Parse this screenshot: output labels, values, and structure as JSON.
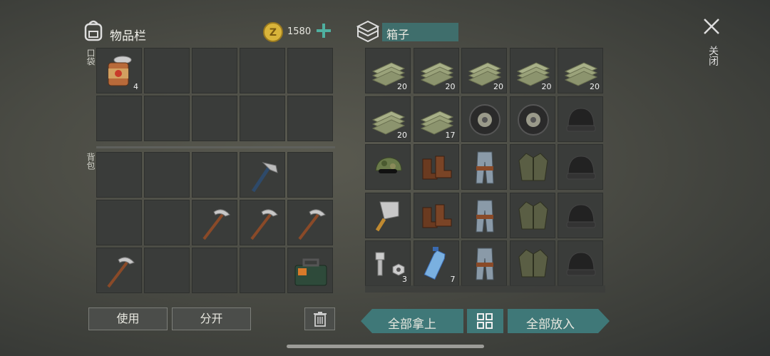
{
  "header": {
    "inventory_title": "物品栏",
    "coins": "1580",
    "container_name": "箱子",
    "close_label": "关闭"
  },
  "sections": {
    "pocket_label": "口袋",
    "backpack_label": "背包"
  },
  "pocket_items": [
    {
      "icon": "canned-food-icon",
      "count": "4"
    }
  ],
  "backpack_items": [
    {
      "icon": "hatchet-icon"
    },
    {
      "icon": "pickaxe-icon"
    },
    {
      "icon": "pickaxe-icon"
    },
    {
      "icon": "pickaxe-icon"
    },
    {
      "icon": "pickaxe-icon"
    },
    {
      "icon": "toolbox-icon"
    }
  ],
  "box_items": [
    {
      "icon": "cloth-icon",
      "count": "20"
    },
    {
      "icon": "cloth-icon",
      "count": "20"
    },
    {
      "icon": "cloth-icon",
      "count": "20"
    },
    {
      "icon": "cloth-icon",
      "count": "20"
    },
    {
      "icon": "cloth-icon",
      "count": "20"
    },
    {
      "icon": "cloth-icon",
      "count": "20"
    },
    {
      "icon": "cloth-icon",
      "count": "17"
    },
    {
      "icon": "tire-icon"
    },
    {
      "icon": "tire-icon"
    },
    {
      "icon": "beanie-icon"
    },
    {
      "icon": "camo-cap-icon"
    },
    {
      "icon": "boots-icon"
    },
    {
      "icon": "jeans-icon"
    },
    {
      "icon": "jacket-icon"
    },
    {
      "icon": "beanie-icon"
    },
    {
      "icon": "cleaver-icon"
    },
    {
      "icon": "boots-icon"
    },
    {
      "icon": "jeans-icon"
    },
    {
      "icon": "jacket-icon"
    },
    {
      "icon": "beanie-icon"
    },
    {
      "icon": "bolt-nut-icon",
      "count": "3"
    },
    {
      "icon": "water-bottle-icon",
      "count": "7"
    },
    {
      "icon": "jeans-icon"
    },
    {
      "icon": "jacket-icon"
    },
    {
      "icon": "beanie-icon"
    }
  ],
  "actions": {
    "use_label": "使用",
    "split_label": "分开",
    "take_all_label": "全部拿上",
    "put_all_label": "全部放入"
  },
  "colors": {
    "accent": "#3f7878",
    "coin": "#d9b43a"
  }
}
